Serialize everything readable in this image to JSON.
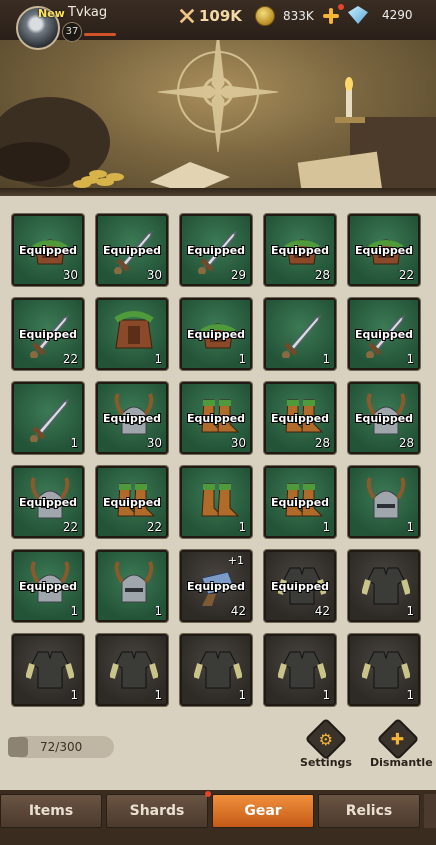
{
  "header": {
    "new_tag": "New",
    "player_name": "Tvkag",
    "level": "37",
    "power": "109K",
    "gold": "833K",
    "gems": "4290"
  },
  "inventory": {
    "equipped_label": "Equipped",
    "capacity": "72/300",
    "items": [
      {
        "type": "helmet-green",
        "equipped": true,
        "count": "30",
        "frame": "green"
      },
      {
        "type": "sword",
        "equipped": true,
        "count": "30",
        "frame": "green"
      },
      {
        "type": "sword",
        "equipped": true,
        "count": "29",
        "frame": "green"
      },
      {
        "type": "helmet-green",
        "equipped": true,
        "count": "28",
        "frame": "green"
      },
      {
        "type": "helmet-green",
        "equipped": true,
        "count": "22",
        "frame": "green"
      },
      {
        "type": "sword",
        "equipped": true,
        "count": "22",
        "frame": "green"
      },
      {
        "type": "chest-green",
        "equipped": false,
        "count": "1",
        "frame": "green"
      },
      {
        "type": "helmet-green",
        "equipped": true,
        "count": "1",
        "frame": "green"
      },
      {
        "type": "sword",
        "equipped": false,
        "count": "1",
        "frame": "green"
      },
      {
        "type": "sword",
        "equipped": true,
        "count": "1",
        "frame": "green"
      },
      {
        "type": "sword",
        "equipped": false,
        "count": "1",
        "frame": "green"
      },
      {
        "type": "helmet-horn",
        "equipped": true,
        "count": "30",
        "frame": "green"
      },
      {
        "type": "boots",
        "equipped": true,
        "count": "30",
        "frame": "green"
      },
      {
        "type": "boots",
        "equipped": true,
        "count": "28",
        "frame": "green"
      },
      {
        "type": "helmet-horn",
        "equipped": true,
        "count": "28",
        "frame": "green"
      },
      {
        "type": "helmet-horn",
        "equipped": true,
        "count": "22",
        "frame": "green"
      },
      {
        "type": "boots",
        "equipped": true,
        "count": "22",
        "frame": "green"
      },
      {
        "type": "boots",
        "equipped": false,
        "count": "1",
        "frame": "green"
      },
      {
        "type": "boots",
        "equipped": true,
        "count": "1",
        "frame": "green"
      },
      {
        "type": "helmet-horn",
        "equipped": false,
        "count": "1",
        "frame": "green"
      },
      {
        "type": "helmet-horn",
        "equipped": true,
        "count": "1",
        "frame": "green"
      },
      {
        "type": "helmet-horn",
        "equipped": false,
        "count": "1",
        "frame": "green"
      },
      {
        "type": "gauntlet",
        "equipped": true,
        "count": "42",
        "frame": "dark",
        "plus": "+1"
      },
      {
        "type": "vest",
        "equipped": true,
        "count": "42",
        "frame": "dark"
      },
      {
        "type": "vest",
        "equipped": false,
        "count": "1",
        "frame": "dark"
      },
      {
        "type": "vest",
        "equipped": false,
        "count": "1",
        "frame": "dark"
      },
      {
        "type": "vest",
        "equipped": false,
        "count": "1",
        "frame": "dark"
      },
      {
        "type": "vest",
        "equipped": false,
        "count": "1",
        "frame": "dark"
      },
      {
        "type": "vest",
        "equipped": false,
        "count": "1",
        "frame": "dark"
      },
      {
        "type": "vest",
        "equipped": false,
        "count": "1",
        "frame": "dark"
      }
    ]
  },
  "actions": {
    "settings": "Settings",
    "dismantle": "Dismantle"
  },
  "tabs": [
    "Items",
    "Shards",
    "Gear",
    "Relics"
  ],
  "active_tab": "Gear"
}
